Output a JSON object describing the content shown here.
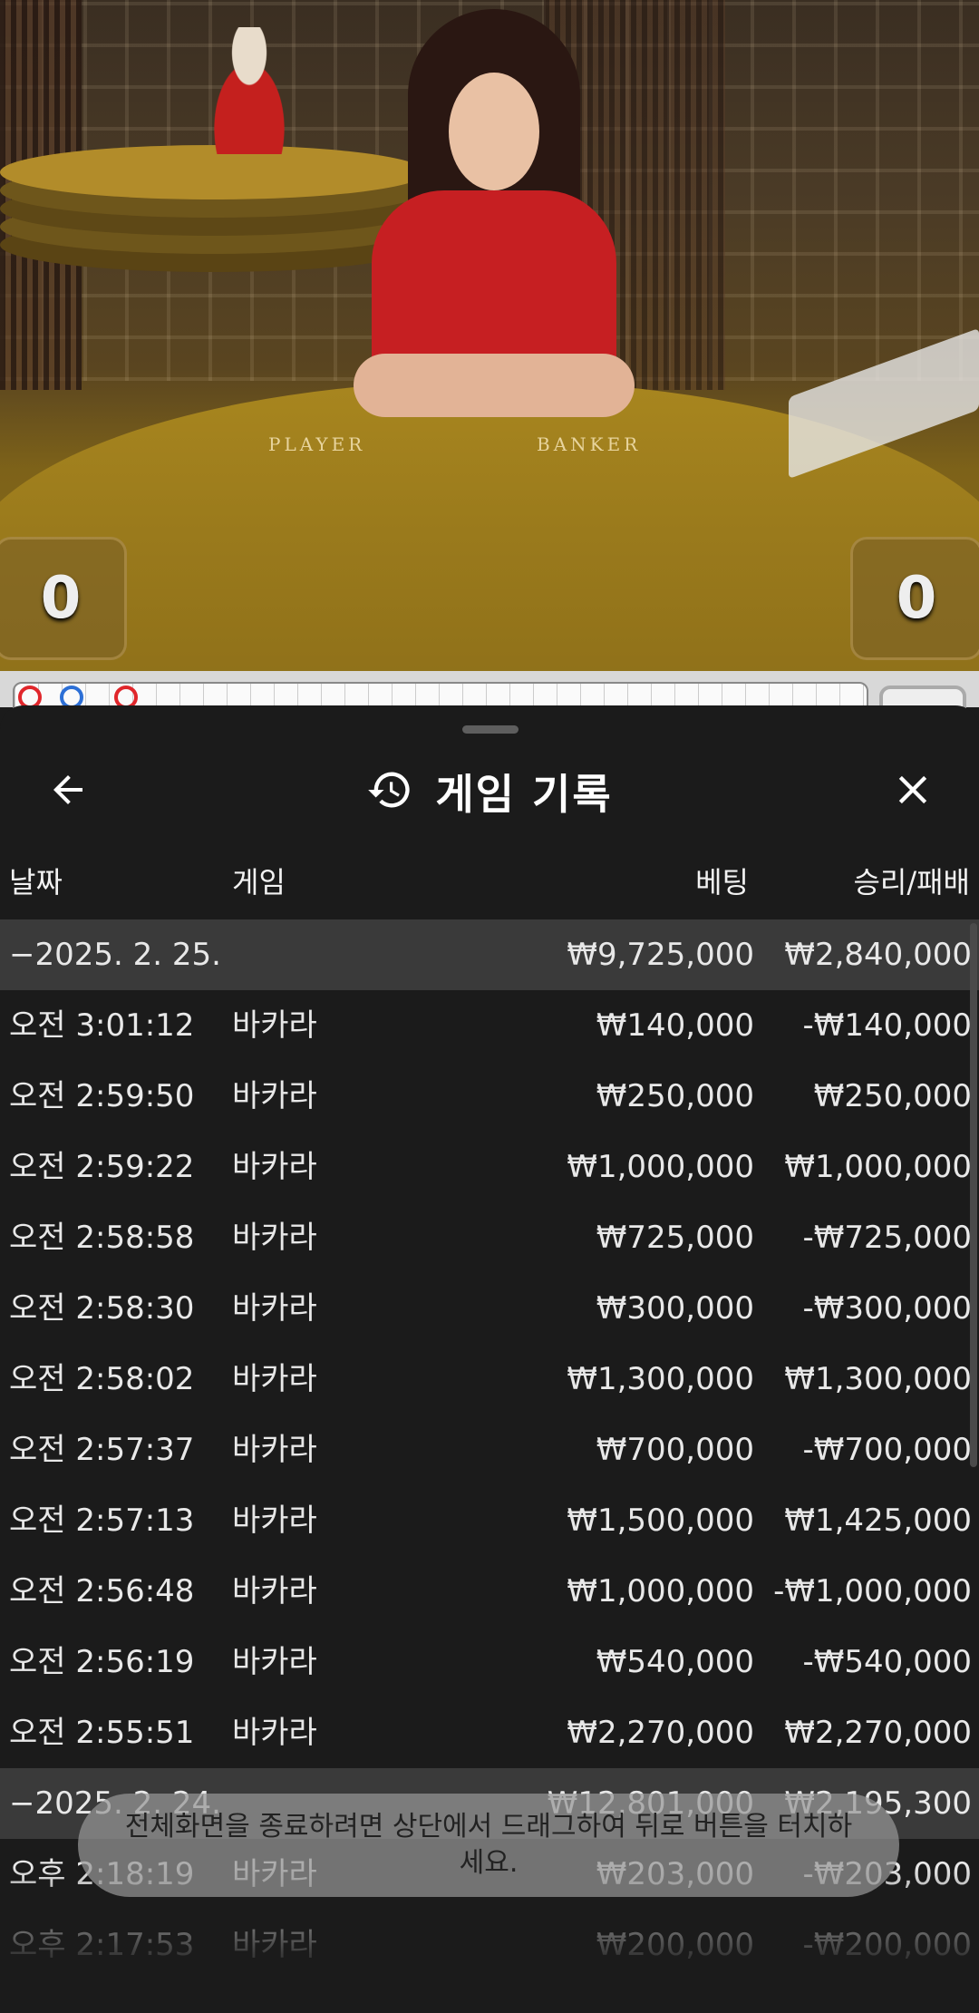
{
  "video": {
    "table_labels": [
      "PLAYER",
      "BANKER"
    ],
    "player_score": "0",
    "banker_score": "0"
  },
  "header": {
    "title": "게임 기록",
    "icons": {
      "back": "arrow-left-icon",
      "history": "history-icon",
      "close": "close-icon"
    }
  },
  "columns": {
    "date": "날짜",
    "game": "게임",
    "bet": "베팅",
    "winloss": "승리/패배"
  },
  "groups": [
    {
      "date": "−2025. 2. 25.",
      "bet_total": "₩9,725,000",
      "winloss_total": "₩2,840,000",
      "rows": [
        {
          "time": "오전 3:01:12",
          "game": "바카라",
          "bet": "₩140,000",
          "winloss": "-₩140,000"
        },
        {
          "time": "오전 2:59:50",
          "game": "바카라",
          "bet": "₩250,000",
          "winloss": "₩250,000"
        },
        {
          "time": "오전 2:59:22",
          "game": "바카라",
          "bet": "₩1,000,000",
          "winloss": "₩1,000,000"
        },
        {
          "time": "오전 2:58:58",
          "game": "바카라",
          "bet": "₩725,000",
          "winloss": "-₩725,000"
        },
        {
          "time": "오전 2:58:30",
          "game": "바카라",
          "bet": "₩300,000",
          "winloss": "-₩300,000"
        },
        {
          "time": "오전 2:58:02",
          "game": "바카라",
          "bet": "₩1,300,000",
          "winloss": "₩1,300,000"
        },
        {
          "time": "오전 2:57:37",
          "game": "바카라",
          "bet": "₩700,000",
          "winloss": "-₩700,000"
        },
        {
          "time": "오전 2:57:13",
          "game": "바카라",
          "bet": "₩1,500,000",
          "winloss": "₩1,425,000"
        },
        {
          "time": "오전 2:56:48",
          "game": "바카라",
          "bet": "₩1,000,000",
          "winloss": "-₩1,000,000"
        },
        {
          "time": "오전 2:56:19",
          "game": "바카라",
          "bet": "₩540,000",
          "winloss": "-₩540,000"
        },
        {
          "time": "오전 2:55:51",
          "game": "바카라",
          "bet": "₩2,270,000",
          "winloss": "₩2,270,000"
        }
      ]
    },
    {
      "date": "−2025. 2. 24.",
      "bet_total": "₩12,801,000",
      "winloss_total": "₩2,195,300",
      "rows": [
        {
          "time": "오후 2:18:19",
          "game": "바카라",
          "bet": "₩203,000",
          "winloss": "-₩203,000"
        },
        {
          "time": "오후 2:17:53",
          "game": "바카라",
          "bet": "₩200,000",
          "winloss": "-₩200,000"
        }
      ]
    }
  ],
  "toast": "전체화면을 종료하려면 상단에서 드래그하여 뒤로 버튼을 터치하세요.",
  "colors": {
    "road_red": "#e0262b",
    "road_blue": "#2c6fd6"
  }
}
